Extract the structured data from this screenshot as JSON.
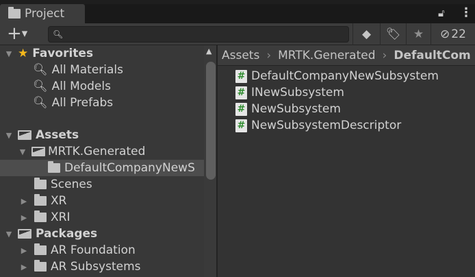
{
  "tab": {
    "title": "Project",
    "icon": "folder-icon"
  },
  "toolbar": {
    "search_placeholder": "",
    "hidden_count": "22"
  },
  "favorites": {
    "label": "Favorites",
    "items": [
      "All Materials",
      "All Models",
      "All Prefabs"
    ]
  },
  "assets": {
    "label": "Assets",
    "items": [
      {
        "label": "MRTK.Generated",
        "expanded": true
      },
      {
        "label": "DefaultCompanyNewS",
        "selected": true
      },
      {
        "label": "Scenes"
      },
      {
        "label": "XR",
        "expandable": true
      },
      {
        "label": "XRI",
        "expandable": true
      }
    ]
  },
  "packages": {
    "label": "Packages",
    "items": [
      "AR Foundation",
      "AR Subsystems"
    ]
  },
  "breadcrumb": [
    "Assets",
    "MRTK.Generated",
    "DefaultCom"
  ],
  "files": [
    "DefaultCompanyNewSubsystem",
    "INewSubsystem",
    "NewSubsystem",
    "NewSubsystemDescriptor"
  ],
  "colors": {
    "star": "#f4b81c",
    "script_hash": "#2e8b2e",
    "selected_row": "#4d4d4d"
  }
}
